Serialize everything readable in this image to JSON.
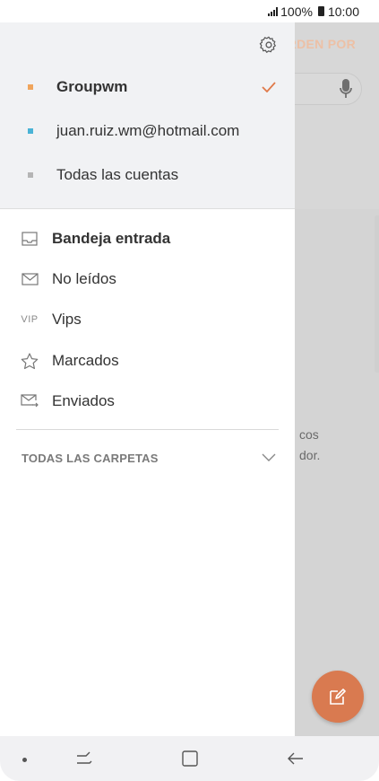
{
  "status_bar": {
    "battery": "100%",
    "time": "10:00"
  },
  "background": {
    "sort_label": "ORDENAR POR",
    "sort_visible": "RDEN POR",
    "empty_line1": "cos",
    "empty_line2": "dor."
  },
  "drawer": {
    "accounts": [
      {
        "label": "Groupwm",
        "color": "#f0a55c",
        "selected": true
      },
      {
        "label": "juan.ruiz.wm@hotmail.com",
        "color": "#4ab3d6",
        "selected": false
      },
      {
        "label": "Todas las cuentas",
        "color": "#b5b5b5",
        "selected": false
      }
    ],
    "folders": [
      {
        "label": "Bandeja entrada",
        "icon": "inbox-icon",
        "bold": true
      },
      {
        "label": "No leídos",
        "icon": "envelope-icon",
        "bold": false
      },
      {
        "label": "Vips",
        "icon": "vip-icon",
        "icon_text": "VIP",
        "bold": false
      },
      {
        "label": "Marcados",
        "icon": "star-icon",
        "bold": false
      },
      {
        "label": "Enviados",
        "icon": "sent-icon",
        "bold": false
      }
    ],
    "all_folders_label": "TODAS LAS CARPETAS"
  },
  "colors": {
    "accent": "#e07a4a",
    "fab": "#d97a50"
  }
}
